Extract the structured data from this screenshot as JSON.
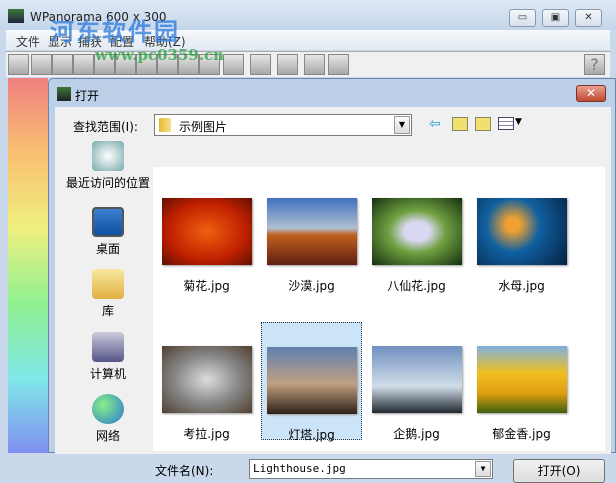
{
  "app": {
    "title": "WPanorama   600 x 300",
    "min": "▭",
    "max": "▣",
    "close": "✕"
  },
  "menu": [
    "文件",
    "显示",
    "捕获",
    "配置",
    "帮助(Z)"
  ],
  "toolbar": {
    "help": "?"
  },
  "watermark": {
    "name": "河东软件园",
    "url": "www.pc0359.cn"
  },
  "dialog": {
    "title": "打开",
    "close": "✕",
    "lookin_label": "查找范围(I):",
    "lookin_value": "示例图片",
    "places": [
      "最近访问的位置",
      "桌面",
      "库",
      "计算机",
      "网络"
    ],
    "files": [
      {
        "name": "菊花.jpg"
      },
      {
        "name": "沙漠.jpg"
      },
      {
        "name": "八仙花.jpg"
      },
      {
        "name": "水母.jpg"
      },
      {
        "name": "考拉.jpg"
      },
      {
        "name": "灯塔.jpg",
        "selected": true
      },
      {
        "name": "企鹅.jpg"
      },
      {
        "name": "郁金香.jpg"
      }
    ],
    "filename_label": "文件名(N):",
    "filename_value": "Lighthouse.jpg",
    "open_button": "打开(O)"
  }
}
